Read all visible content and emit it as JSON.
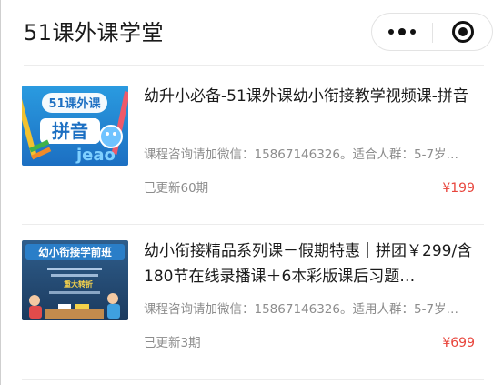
{
  "header": {
    "title": "51课外课学堂",
    "more_icon": "more-dots-icon",
    "close_icon": "target-circle-icon"
  },
  "courses": [
    {
      "thumb_icon": "course-cover-pinyin",
      "title": "幼升小必备-51课外课幼小衔接教学视频课-拼音",
      "description": "课程咨询请加微信：15867146326。适合人群：5-7岁…",
      "updated": "已更新60期",
      "price": "¥199"
    },
    {
      "thumb_icon": "course-cover-preschool",
      "title": "幼小衔接精品系列课－假期特惠｜拼团￥299/含180节在线录播课＋6本彩版课后习题…",
      "description": "课程咨询请加微信：15867146326。适用人群：5-7岁…",
      "updated": "已更新3期",
      "price": "¥699"
    }
  ],
  "colors": {
    "price": "#e8453c",
    "muted": "#8c8c8c",
    "divider": "#ececec"
  }
}
